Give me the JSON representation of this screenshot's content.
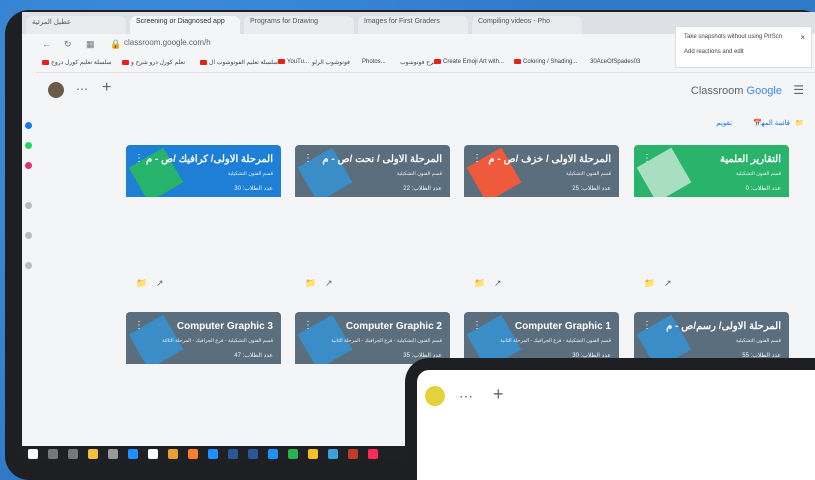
{
  "browser": {
    "tabs": [
      {
        "label": "عطيل المرئية"
      },
      {
        "label": "Screening or Diagnosed app"
      },
      {
        "label": "Programs for Drawing"
      },
      {
        "label": "Images for First Graders"
      },
      {
        "label": "Compiling videos - Pho"
      }
    ],
    "address_url": "classroom.google.com/h",
    "bookmarks": [
      "سلسلة تعليم كورل دروج",
      "تعلم كورل درو شرح و",
      "سلسلة تعليم الفوتوشوب ال",
      "YouTu...",
      "فوتوشوب الرلو",
      "Photos...",
      "شرح فوتوشوب",
      "Create Emoji Art with...",
      "Coloring / Shading...",
      "30AceOfSpades03"
    ],
    "extension_popup": {
      "line1": "Take snapshots without using PrtScn",
      "line2": "Add reactions and edit"
    }
  },
  "classroom": {
    "brand_prefix": "Classroom",
    "brand_google": "Google",
    "toolbar": {
      "calendar": "تقويم",
      "todo": "قائمة المهام"
    },
    "cards": [
      {
        "title": "التقارير العلمية",
        "subtitle": "قسم الفنون التشكيلية",
        "count": "عدد الطلاب: 0",
        "color": "#29b36b"
      },
      {
        "title": "المرحلة الاولى / خزف /ص - م",
        "subtitle": "قسم الفنون التشكيلية",
        "count": "عدد الطلاب: 25",
        "color": "#5b6e7d"
      },
      {
        "title": "المرحلة الاولى / نحت /ص - م",
        "subtitle": "قسم الفنون التشكيلية",
        "count": "عدد الطلاب: 22",
        "color": "#5b6e7d"
      },
      {
        "title": "المرحلة الاولى/ كرافيك /ص - م",
        "subtitle": "قسم الفنون التشكيلية",
        "count": "عدد الطلاب: 30",
        "color": "#1d7fd6"
      },
      {
        "title": "المرحلة الاولى/ رسم/ص - م",
        "subtitle": "قسم الفنون التشكيلية",
        "count": "عدد الطلاب: 55",
        "color": "#5b6e7d"
      },
      {
        "title": "Computer Graphic 1",
        "subtitle": "قسم الفنون التشكيلية - فرع الجرافيك - المرحلة الثانية",
        "count": "عدد الطلاب: 30",
        "color": "#5b6e7d"
      },
      {
        "title": "Computer Graphic 2",
        "subtitle": "قسم الفنون التشكيلية - فرع الجرافيك - المرحلة الثانية",
        "count": "عدد الطلاب: 35",
        "color": "#5b6e7d"
      },
      {
        "title": "Computer Graphic 3",
        "subtitle": "قسم الفنون التشكيلية - فرع الجرافيك - المرحلة الثالثة",
        "count": "عدد الطلاب: 47",
        "color": "#5b6e7d"
      }
    ]
  }
}
